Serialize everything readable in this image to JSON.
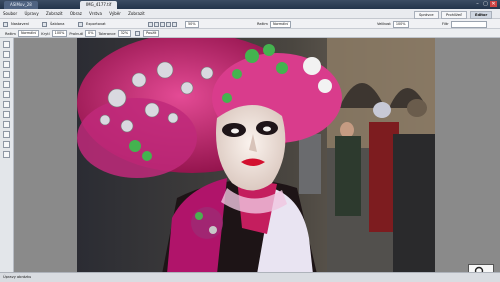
{
  "window": {
    "tabs": [
      {
        "label": "ASIMov_28"
      },
      {
        "label": "IMG_4177.tif"
      }
    ],
    "controls": [
      "–",
      "▢",
      "✕"
    ]
  },
  "menubar": {
    "items": [
      "Soubor",
      "Úpravy",
      "Zobrazit",
      "Obraz",
      "Vrstva",
      "Výběr",
      "Zobrazit"
    ],
    "mode_tabs": [
      "Správce",
      "Prohlížeč",
      "Editor"
    ],
    "active_mode": "Editor"
  },
  "toolbar1": {
    "buttons": [
      "Nastavení",
      "Šablona",
      "Exportovat"
    ],
    "zoom_value": "50%",
    "mode_label": "Režim",
    "mode_value": "Normální",
    "size_label": "Velikost",
    "size_value": "100%",
    "filter_label": "Filtr"
  },
  "toolbar2": {
    "fields": [
      {
        "label": "Režim",
        "value": "Normální"
      },
      {
        "label": "Krytí",
        "value": "100%"
      },
      {
        "label": "Prolnutí",
        "value": "0%"
      },
      {
        "label": "Tolerance",
        "value": "32%"
      }
    ],
    "apply_label": "Použít"
  },
  "status": {
    "left": "Úpravy obrázku"
  },
  "colors": {
    "tabbar": "#23344b",
    "menubar": "#e9ebef",
    "canvas_bg": "#8a8a8a",
    "pink": "#d6357f",
    "magenta": "#b1145a"
  },
  "icons": {
    "zoom": "magnifier-icon"
  }
}
